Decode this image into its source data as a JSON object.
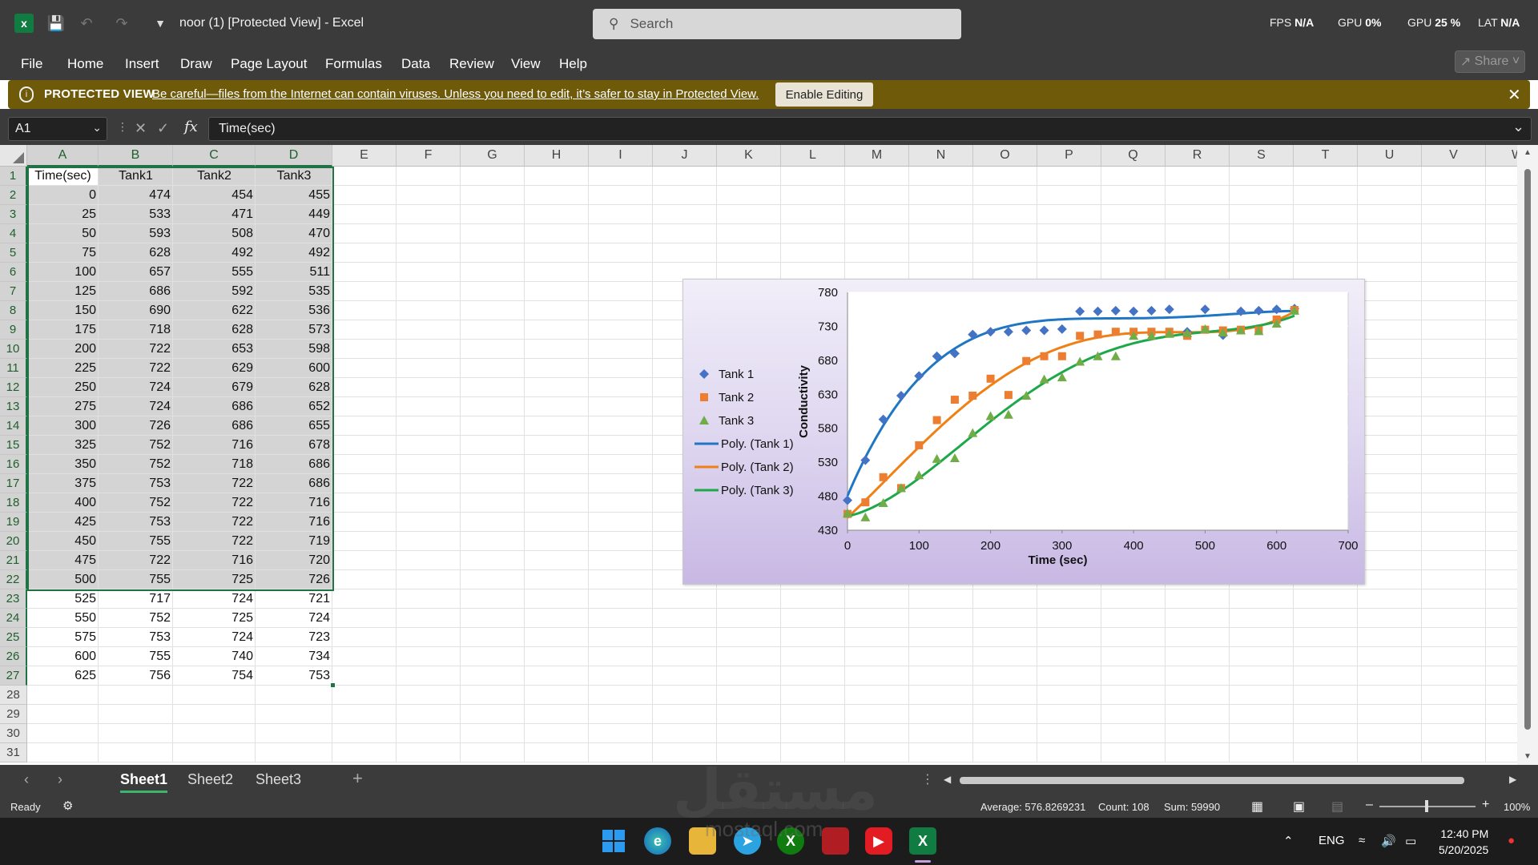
{
  "app": {
    "doc_title": "noor (1)  [Protected View]  -  Excel",
    "search_placeholder": "Search",
    "perf": {
      "fps_label": "FPS",
      "fps_val": "N/A",
      "gpu_label": "GPU",
      "gpu_val": "0%",
      "gpu2_label": "GPU",
      "gpu2_val": "25 %",
      "lat_label": "LAT",
      "lat_val": "N/A"
    },
    "share_label": "Share"
  },
  "menu": [
    "File",
    "Home",
    "Insert",
    "Draw",
    "Page Layout",
    "Formulas",
    "Data",
    "Review",
    "View",
    "Help"
  ],
  "protected": {
    "label": "PROTECTED VIEW",
    "message": "Be careful—files from the Internet can contain viruses. Unless you need to edit, it’s safer to stay in Protected View.",
    "button": "Enable Editing"
  },
  "formula_bar": {
    "name_box": "A1",
    "formula": "Time(sec)"
  },
  "columns": [
    "A",
    "B",
    "C",
    "D",
    "E",
    "F",
    "G",
    "H",
    "I",
    "J",
    "K",
    "L",
    "M",
    "N",
    "O",
    "P",
    "Q",
    "R",
    "S",
    "T",
    "U",
    "V",
    "W"
  ],
  "rows": [
    "1",
    "2",
    "3",
    "4",
    "5",
    "6",
    "7",
    "8",
    "9",
    "10",
    "11",
    "12",
    "13",
    "14",
    "15",
    "16",
    "17",
    "18",
    "19",
    "20",
    "21",
    "22",
    "23",
    "24",
    "25",
    "26",
    "27",
    "28",
    "29",
    "30",
    "31"
  ],
  "table": {
    "headers": [
      "Time(sec)",
      "Tank1",
      "Tank2",
      "Tank3"
    ],
    "rows": [
      [
        "0",
        "474",
        "454",
        "455"
      ],
      [
        "25",
        "533",
        "471",
        "449"
      ],
      [
        "50",
        "593",
        "508",
        "470"
      ],
      [
        "75",
        "628",
        "492",
        "492"
      ],
      [
        "100",
        "657",
        "555",
        "511"
      ],
      [
        "125",
        "686",
        "592",
        "535"
      ],
      [
        "150",
        "690",
        "622",
        "536"
      ],
      [
        "175",
        "718",
        "628",
        "573"
      ],
      [
        "200",
        "722",
        "653",
        "598"
      ],
      [
        "225",
        "722",
        "629",
        "600"
      ],
      [
        "250",
        "724",
        "679",
        "628"
      ],
      [
        "275",
        "724",
        "686",
        "652"
      ],
      [
        "300",
        "726",
        "686",
        "655"
      ],
      [
        "325",
        "752",
        "716",
        "678"
      ],
      [
        "350",
        "752",
        "718",
        "686"
      ],
      [
        "375",
        "753",
        "722",
        "686"
      ],
      [
        "400",
        "752",
        "722",
        "716"
      ],
      [
        "425",
        "753",
        "722",
        "716"
      ],
      [
        "450",
        "755",
        "722",
        "719"
      ],
      [
        "475",
        "722",
        "716",
        "720"
      ],
      [
        "500",
        "755",
        "725",
        "726"
      ],
      [
        "525",
        "717",
        "724",
        "721"
      ],
      [
        "550",
        "752",
        "725",
        "724"
      ],
      [
        "575",
        "753",
        "724",
        "723"
      ],
      [
        "600",
        "755",
        "740",
        "734"
      ],
      [
        "625",
        "756",
        "754",
        "753"
      ]
    ]
  },
  "chart_data": {
    "type": "scatter",
    "title": "",
    "xlabel": "Time (sec)",
    "ylabel": "Conductivity",
    "xlim": [
      0,
      700
    ],
    "ylim": [
      430,
      780
    ],
    "xticks": [
      "0",
      "100",
      "200",
      "300",
      "400",
      "500",
      "600",
      "700"
    ],
    "yticks": [
      "430",
      "480",
      "530",
      "580",
      "630",
      "680",
      "730",
      "780"
    ],
    "legend_position": "left",
    "x": [
      0,
      25,
      50,
      75,
      100,
      125,
      150,
      175,
      200,
      225,
      250,
      275,
      300,
      325,
      350,
      375,
      400,
      425,
      450,
      475,
      500,
      525,
      550,
      575,
      600,
      625
    ],
    "series": [
      {
        "name": "Tank 1",
        "marker": "diamond",
        "color": "#4472c4",
        "values": [
          474,
          533,
          593,
          628,
          657,
          686,
          690,
          718,
          722,
          722,
          724,
          724,
          726,
          752,
          752,
          753,
          752,
          753,
          755,
          722,
          755,
          717,
          752,
          753,
          755,
          756
        ]
      },
      {
        "name": "Tank 2",
        "marker": "square",
        "color": "#ed7d31",
        "values": [
          454,
          471,
          508,
          492,
          555,
          592,
          622,
          628,
          653,
          629,
          679,
          686,
          686,
          716,
          718,
          722,
          722,
          722,
          722,
          716,
          725,
          724,
          725,
          724,
          740,
          754
        ]
      },
      {
        "name": "Tank 3",
        "marker": "triangle",
        "color": "#70ad47",
        "values": [
          455,
          449,
          470,
          492,
          511,
          535,
          536,
          573,
          598,
          600,
          628,
          652,
          655,
          678,
          686,
          686,
          716,
          716,
          719,
          720,
          726,
          721,
          724,
          723,
          734,
          753
        ]
      }
    ],
    "trendlines": [
      {
        "name": "Poly. (Tank 1)",
        "color": "#1f77c4"
      },
      {
        "name": "Poly. (Tank 2)",
        "color": "#f07f14"
      },
      {
        "name": "Poly. (Tank 3)",
        "color": "#1fa84a"
      }
    ]
  },
  "sheets": [
    "Sheet1",
    "Sheet2",
    "Sheet3"
  ],
  "status": {
    "ready": "Ready",
    "average": "Average: 576.8269231",
    "count": "Count: 108",
    "sum": "Sum: 59990",
    "zoom": "100%"
  },
  "taskbar": {
    "lang": "ENG",
    "time": "12:40 PM",
    "date": "5/20/2025"
  },
  "watermark": {
    "arabic": "مستقل",
    "latin": "mostaql.com"
  }
}
